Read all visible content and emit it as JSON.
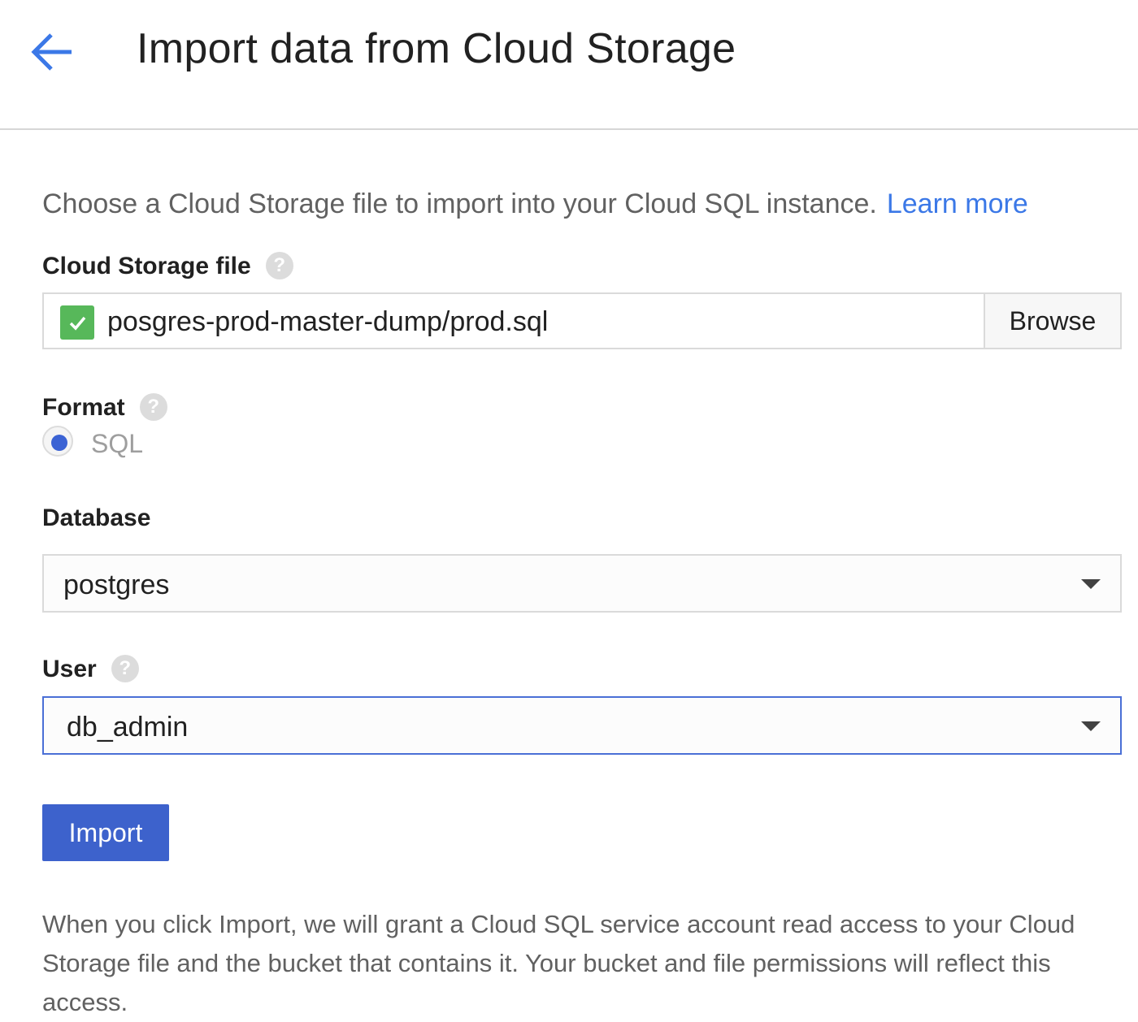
{
  "header": {
    "back_icon": "arrow-back-icon",
    "title": "Import data from Cloud Storage"
  },
  "intro": {
    "text": "Choose a Cloud Storage file to import into your Cloud SQL instance.",
    "link": "Learn more"
  },
  "cloud_storage_file": {
    "label": "Cloud Storage file",
    "help": "?",
    "value": "posgres-prod-master-dump/prod.sql",
    "status_icon": "check-icon",
    "browse_label": "Browse"
  },
  "format": {
    "label": "Format",
    "help": "?",
    "option": "SQL",
    "selected": true
  },
  "database": {
    "label": "Database",
    "value": "postgres"
  },
  "user": {
    "label": "User",
    "help": "?",
    "value": "db_admin"
  },
  "import_button": "Import",
  "footnote": "When you click Import, we will grant a Cloud SQL service account read access to your Cloud Storage file and the bucket that contains it. Your bucket and file permissions will reflect this access.",
  "colors": {
    "accent": "#3d62cc",
    "link": "#3b78e7",
    "success": "#57b85a"
  }
}
